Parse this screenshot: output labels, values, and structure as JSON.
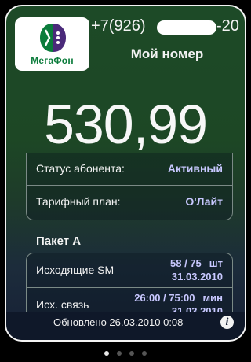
{
  "brand": {
    "logo_text": "МегаФон",
    "brand_color": "#0b7c3b"
  },
  "header": {
    "phone_prefix": "+7(926)",
    "phone_suffix": "-20",
    "title": "Мой номер"
  },
  "balance": {
    "value": "530,99"
  },
  "status_group": {
    "rows": [
      {
        "label": "Статус абонента:",
        "value": "Активный"
      },
      {
        "label": "Тарифный план:",
        "value": "О'Лайт"
      }
    ]
  },
  "packet": {
    "title": "Пакет А",
    "rows": [
      {
        "label": "Исходящие SM",
        "usage": "58 / 75",
        "unit": "шт",
        "date": "31.03.2010"
      },
      {
        "label": "Исх. связь",
        "usage": "26:00 / 75:00",
        "unit": "мин",
        "date": "31.03.2010"
      }
    ]
  },
  "footer": {
    "updated": "Обновлено 26.03.2010 0:08",
    "info_icon": "info-icon"
  },
  "pager": {
    "pages": 4,
    "active_index": 0
  },
  "colors": {
    "accent_value": "#c8c8ff",
    "background_top": "#1d4a27",
    "background_bottom": "#172036"
  }
}
